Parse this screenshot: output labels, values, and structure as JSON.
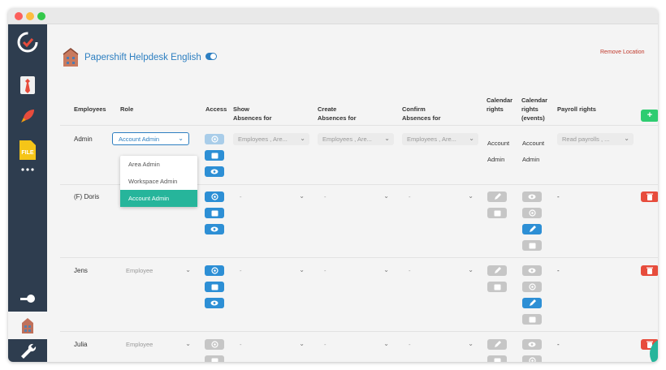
{
  "colors": {
    "accent": "#2d8fd5",
    "danger": "#e74c3c",
    "success": "#2ecc71",
    "teal": "#26b59b",
    "sidebar": "#2e3d4f"
  },
  "sidebar": {
    "items": [
      {
        "icon": "papershift-logo-icon"
      },
      {
        "icon": "employee-tie-icon"
      },
      {
        "icon": "rocket-icon"
      },
      {
        "icon": "file-icon",
        "label": "FILE"
      },
      {
        "icon": "more-dots-icon"
      },
      {
        "icon": "key-icon"
      },
      {
        "icon": "building-icon",
        "active": true
      },
      {
        "icon": "wrench-icon"
      }
    ]
  },
  "header": {
    "title": "Papershift Helpdesk English",
    "remove_location": "Remove Location"
  },
  "table": {
    "columns": {
      "employees": "Employees",
      "role": "Role",
      "access": "Access",
      "show_absences": [
        "Show",
        "Absences for"
      ],
      "create_absences": [
        "Create",
        "Absences for"
      ],
      "confirm_absences": [
        "Confirm",
        "Absences for"
      ],
      "calendar_rights": [
        "Calendar",
        "rights"
      ],
      "calendar_rights_events": [
        "Calendar",
        "rights",
        "(events)"
      ],
      "payroll_rights": "Payroll rights"
    },
    "rows": [
      {
        "name": "Admin",
        "role": "Account Admin",
        "show": "Employees , Are...",
        "create": "Employees , Are...",
        "confirm": "Employees , Are...",
        "calendar": [
          "Account",
          "Admin"
        ],
        "calendar_events": [
          "Account",
          "Admin"
        ],
        "payroll": "Read payrolls , ..."
      },
      {
        "name": "(F) Doris",
        "show": "-",
        "create": "-",
        "confirm": "-",
        "payroll": "-"
      },
      {
        "name": "Jens",
        "role": "Employee",
        "show": "-",
        "create": "-",
        "confirm": "-",
        "payroll": "-"
      },
      {
        "name": "Julia",
        "role": "Employee",
        "show": "-",
        "create": "-",
        "confirm": "-",
        "payroll": "-"
      }
    ]
  },
  "role_dropdown": {
    "options": [
      "Area Admin",
      "Workspace Admin",
      "Account Admin"
    ],
    "selected": "Account Admin"
  },
  "glyphs": {
    "chevron": "⌄",
    "plus": "+"
  }
}
